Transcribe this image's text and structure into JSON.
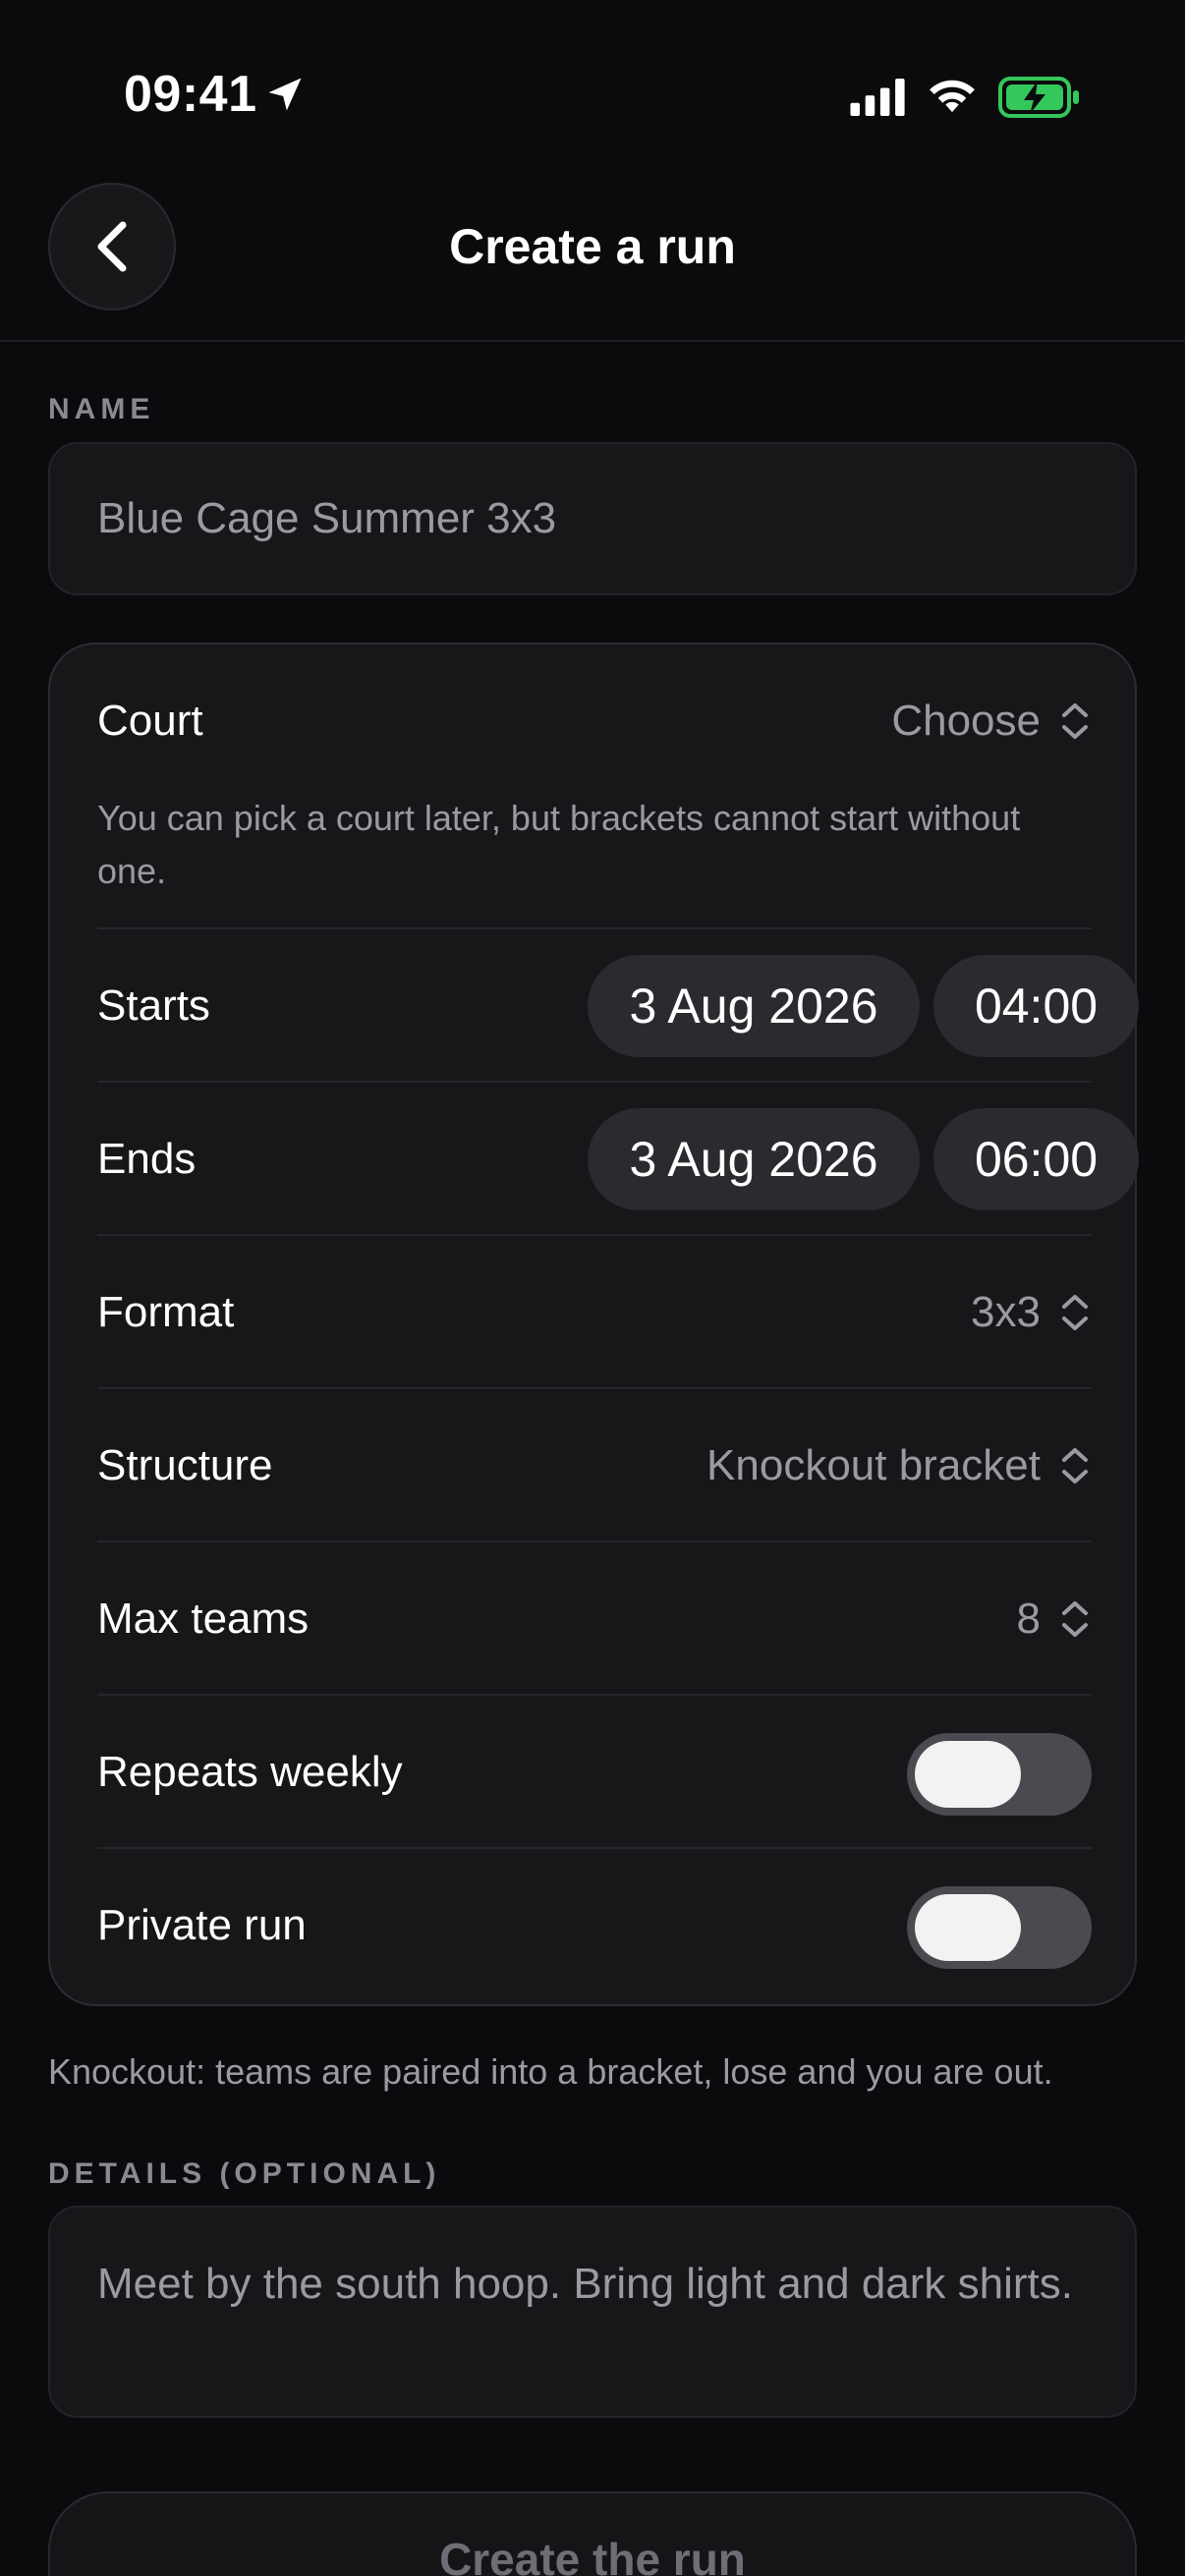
{
  "status_bar": {
    "time": "09:41"
  },
  "header": {
    "title": "Create a run"
  },
  "name": {
    "label": "NAME",
    "placeholder": "Blue Cage Summer 3x3"
  },
  "card": {
    "court": {
      "label": "Court",
      "value": "Choose",
      "hint": "You can pick a court later, but brackets cannot start without one."
    },
    "starts": {
      "label": "Starts",
      "date": "3 Aug 2026",
      "time": "04:00"
    },
    "ends": {
      "label": "Ends",
      "date": "3 Aug 2026",
      "time": "06:00"
    },
    "format": {
      "label": "Format",
      "value": "3x3"
    },
    "structure": {
      "label": "Structure",
      "value": "Knockout bracket"
    },
    "max_teams": {
      "label": "Max teams",
      "value": "8"
    },
    "repeats_weekly": {
      "label": "Repeats weekly",
      "on": false
    },
    "private_run": {
      "label": "Private run",
      "on": false
    }
  },
  "footnote": "Knockout: teams are paired into a bracket, lose and you are out.",
  "details": {
    "label": "DETAILS (OPTIONAL)",
    "placeholder": "Meet by the south hoop. Bring light and dark shirts."
  },
  "create_button": {
    "label": "Create the run"
  },
  "colors": {
    "background": "#0b0b0d",
    "card": "#17171a",
    "battery": "#34c759"
  }
}
